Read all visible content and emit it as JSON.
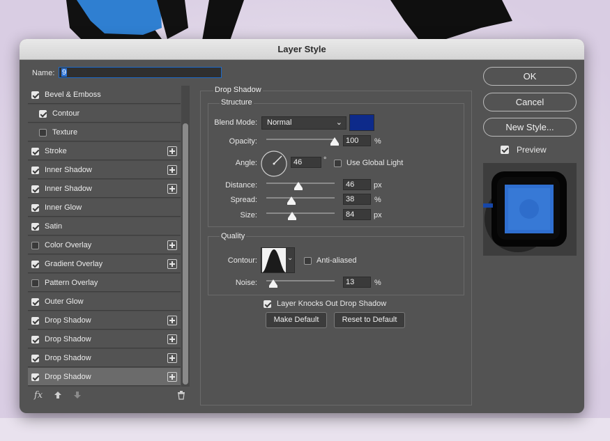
{
  "dialog": {
    "title": "Layer Style"
  },
  "name": {
    "label": "Name:",
    "value": "9"
  },
  "effects": [
    {
      "label": "Bevel & Emboss",
      "checked": true,
      "plus": false,
      "indent": false
    },
    {
      "label": "Contour",
      "checked": true,
      "plus": false,
      "indent": true
    },
    {
      "label": "Texture",
      "checked": false,
      "plus": false,
      "indent": true
    },
    {
      "label": "Stroke",
      "checked": true,
      "plus": true,
      "indent": false
    },
    {
      "label": "Inner Shadow",
      "checked": true,
      "plus": true,
      "indent": false
    },
    {
      "label": "Inner Shadow",
      "checked": true,
      "plus": true,
      "indent": false
    },
    {
      "label": "Inner Glow",
      "checked": true,
      "plus": false,
      "indent": false
    },
    {
      "label": "Satin",
      "checked": true,
      "plus": false,
      "indent": false
    },
    {
      "label": "Color Overlay",
      "checked": false,
      "plus": true,
      "indent": false
    },
    {
      "label": "Gradient Overlay",
      "checked": true,
      "plus": true,
      "indent": false
    },
    {
      "label": "Pattern Overlay",
      "checked": false,
      "plus": false,
      "indent": false
    },
    {
      "label": "Outer Glow",
      "checked": true,
      "plus": false,
      "indent": false
    },
    {
      "label": "Drop Shadow",
      "checked": true,
      "plus": true,
      "indent": false
    },
    {
      "label": "Drop Shadow",
      "checked": true,
      "plus": true,
      "indent": false
    },
    {
      "label": "Drop Shadow",
      "checked": true,
      "plus": true,
      "indent": false
    },
    {
      "label": "Drop Shadow",
      "checked": true,
      "plus": true,
      "indent": false,
      "selected": true
    }
  ],
  "toolbar": {
    "fx": "fx",
    "up_icon": "arrow-up-icon",
    "down_icon": "arrow-down-icon",
    "trash_icon": "trash-icon"
  },
  "panel": {
    "title": "Drop Shadow",
    "structure": {
      "title": "Structure",
      "blend_mode_label": "Blend Mode:",
      "blend_mode": "Normal",
      "shadow_color": "#0d2a8a",
      "opacity_label": "Opacity:",
      "opacity": "100",
      "opacity_unit": "%",
      "angle_label": "Angle:",
      "angle": "46",
      "angle_unit": "°",
      "global_light_label": "Use Global Light",
      "global_light": false,
      "distance_label": "Distance:",
      "distance": "46",
      "distance_unit": "px",
      "spread_label": "Spread:",
      "spread": "38",
      "spread_unit": "%",
      "size_label": "Size:",
      "size": "84",
      "size_unit": "px"
    },
    "quality": {
      "title": "Quality",
      "contour_label": "Contour:",
      "anti_aliased_label": "Anti-aliased",
      "anti_aliased": false,
      "noise_label": "Noise:",
      "noise": "13",
      "noise_unit": "%"
    },
    "knockout_label": "Layer Knocks Out Drop Shadow",
    "knockout": true,
    "make_default": "Make Default",
    "reset_default": "Reset to Default"
  },
  "buttons": {
    "ok": "OK",
    "cancel": "Cancel",
    "new_style": "New Style...",
    "preview": "Preview",
    "preview_checked": true
  }
}
